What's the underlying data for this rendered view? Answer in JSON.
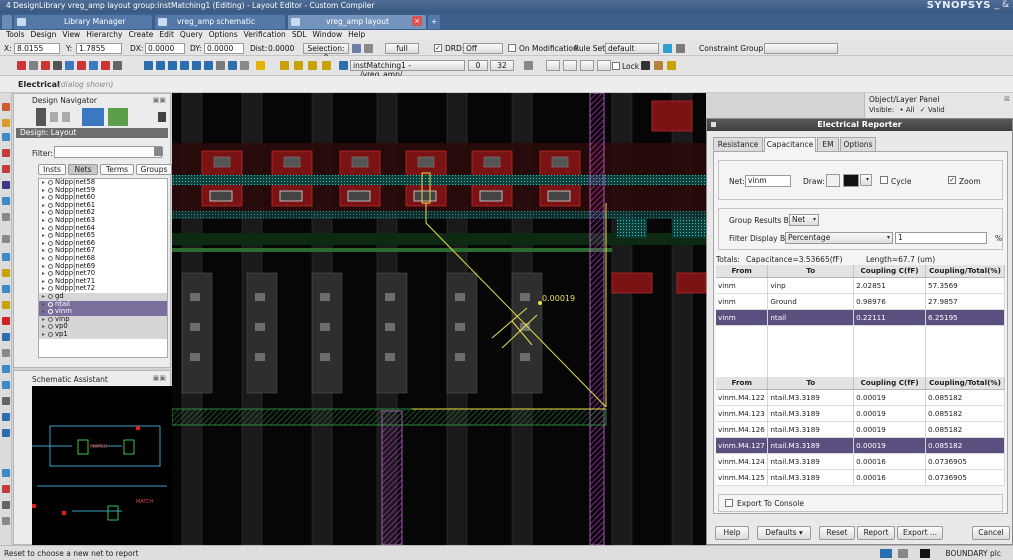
{
  "window": {
    "title": "4 DesignLibrary vreg_amp layout group:instMatching1 (Editing) - Layout Editor - Custom Compiler",
    "brand": "SYNOPSYS",
    "controls": "_ & "
  },
  "tabs": [
    {
      "label": "Library Manager"
    },
    {
      "label": "vreg_amp schematic"
    },
    {
      "label": "vreg_amp layout"
    }
  ],
  "menu": [
    "Tools",
    "Design",
    "View",
    "Hierarchy",
    "Create",
    "Edit",
    "Query",
    "Options",
    "Verification",
    "SDL",
    "Window",
    "Help"
  ],
  "toolbar1": {
    "x_label": "X:",
    "x_value": "8.0155",
    "y_label": "Y:",
    "y_value": "1.7855",
    "dx_label": "DX:",
    "dx_value": "0.0000",
    "dy_label": "DY:",
    "dy_value": "0.0000",
    "dist_label": "Dist:",
    "dist_value": "0.0000",
    "selection_label": "Selection: 0",
    "full_label": "full",
    "drd_label": "DRD:",
    "drd_value": "Off",
    "onmod_label": "On Modification",
    "ruleset_label": "Rule Set:",
    "ruleset_value": "default",
    "constraint_label": "Constraint Group:"
  },
  "toolbar2": {
    "inst_path": "instMatching1 - .../vreg_amp/...",
    "num1": "0",
    "num2": "32",
    "lock_label": "Lock"
  },
  "electrical": {
    "label": "Electrical",
    "dialog": "(dialog shown)"
  },
  "design_navigator": {
    "title": "Design Navigator",
    "design_label": "Design: Layout",
    "filter_label": "Filter:",
    "tabs": [
      "Insts",
      "Nets",
      "Terms",
      "Groups"
    ],
    "nets": [
      {
        "label": "Ndpp|net58"
      },
      {
        "label": "Ndpp|net59"
      },
      {
        "label": "Ndpp|net60"
      },
      {
        "label": "Ndpp|net61"
      },
      {
        "label": "Ndpp|net62"
      },
      {
        "label": "Ndpp|net63"
      },
      {
        "label": "Ndpp|net64"
      },
      {
        "label": "Ndpp|net65"
      },
      {
        "label": "Ndpp|net66"
      },
      {
        "label": "Ndpp|net67"
      },
      {
        "label": "Ndpp|net68"
      },
      {
        "label": "Ndpp|net69"
      },
      {
        "label": "Ndpp|net70"
      },
      {
        "label": "Ndpp|net71"
      },
      {
        "label": "Ndpp|net72"
      },
      {
        "label": "gd"
      },
      {
        "label": "ntail"
      },
      {
        "label": "vinm"
      },
      {
        "label": "vinp"
      },
      {
        "label": "vp0"
      },
      {
        "label": "vp1"
      }
    ]
  },
  "schematic_assistant": {
    "title": "Schematic Assistant",
    "label1": "MATCH",
    "label2": "MATCH"
  },
  "canvas": {
    "marker_value": "0.00019"
  },
  "object_layer_panel": {
    "title": "Object/Layer Panel",
    "visible_label": "Visible:",
    "all_label": "All",
    "valid_label": "Valid"
  },
  "reporter": {
    "title": "Electrical Reporter",
    "tabs": [
      "Resistance",
      "Capacitance",
      "EM",
      "Options"
    ],
    "net_label": "Net:",
    "net_value": "vinm",
    "draw_label": "Draw:",
    "cycle_label": "Cycle",
    "zoom_label": "Zoom",
    "group_by_label": "Group Results By",
    "group_by_value": "Net",
    "filter_by_label": "Filter Display By",
    "filter_by_value": "Percentage",
    "filter_number": "1",
    "percent_sign": "%",
    "totals_label": "Totals:",
    "totals_cap": "Capacitance=3.53665(fF)",
    "totals_len": "Length=67.7 (um)",
    "table1": {
      "columns": [
        "From",
        "To",
        "Coupling C(fF)",
        "Coupling/Total(%)"
      ],
      "rows": [
        [
          "vinm",
          "vinp",
          "2.02851",
          "57.3569"
        ],
        [
          "vinm",
          "Ground",
          "0.98976",
          "27.9857"
        ],
        [
          "vinm",
          "ntail",
          "0.22111",
          "6.25195"
        ]
      ]
    },
    "table2": {
      "columns": [
        "From",
        "To",
        "Coupling C(fF)",
        "Coupling/Total(%)"
      ],
      "rows": [
        [
          "vinm.M4.122",
          "ntail.M3.3189",
          "0.00019",
          "0.085182"
        ],
        [
          "vinm.M4.123",
          "ntail.M3.3189",
          "0.00019",
          "0.085182"
        ],
        [
          "vinm.M4.126",
          "ntail.M3.3189",
          "0.00019",
          "0.085182"
        ],
        [
          "vinm.M4.127",
          "ntail.M3.3189",
          "0.00019",
          "0.085182"
        ],
        [
          "vinm.M4.124",
          "ntail.M3.3189",
          "0.00016",
          "0.0736905"
        ],
        [
          "vinm.M4.125",
          "ntail.M3.3189",
          "0.00016",
          "0.0736905"
        ]
      ]
    },
    "export_label": "Export To Console",
    "buttons": {
      "help": "Help",
      "defaults": "Defaults",
      "reset": "Reset",
      "report": "Report",
      "export": "Export ...",
      "cancel": "Cancel"
    }
  },
  "status": {
    "message": "Reset to choose a new net to report",
    "layer": "BOUNDARY plc"
  }
}
